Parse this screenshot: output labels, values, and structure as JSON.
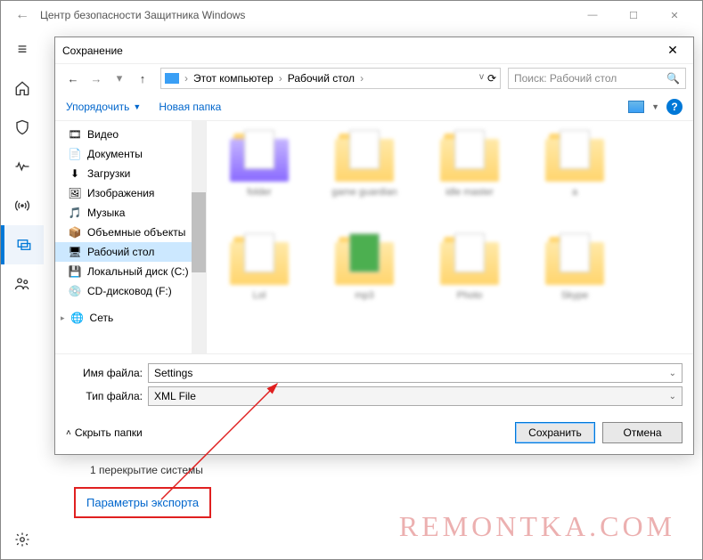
{
  "main": {
    "title": "Центр безопасности Защитника Windows"
  },
  "dialog": {
    "title": "Сохранение",
    "breadcrumb": {
      "pc": "Этот компьютер",
      "folder": "Рабочий стол"
    },
    "search_placeholder": "Поиск: Рабочий стол",
    "organize": "Упорядочить",
    "new_folder": "Новая папка",
    "tree": {
      "video": "Видео",
      "documents": "Документы",
      "downloads": "Загрузки",
      "pictures": "Изображения",
      "music": "Музыка",
      "objects3d": "Объемные объекты",
      "desktop": "Рабочий стол",
      "localdisk": "Локальный диск (C:)",
      "cddrive": "CD-дисковод (F:)",
      "network": "Сеть"
    },
    "filename_label": "Имя файла:",
    "filename_value": "Settings",
    "filetype_label": "Тип файла:",
    "filetype_value": "XML File",
    "hide_folders": "Скрыть папки",
    "save": "Сохранить",
    "cancel": "Отмена"
  },
  "under": {
    "overlay_text": "1 перекрытие системы",
    "export_link": "Параметры экспорта"
  },
  "watermark": "REMONTKA.COM"
}
